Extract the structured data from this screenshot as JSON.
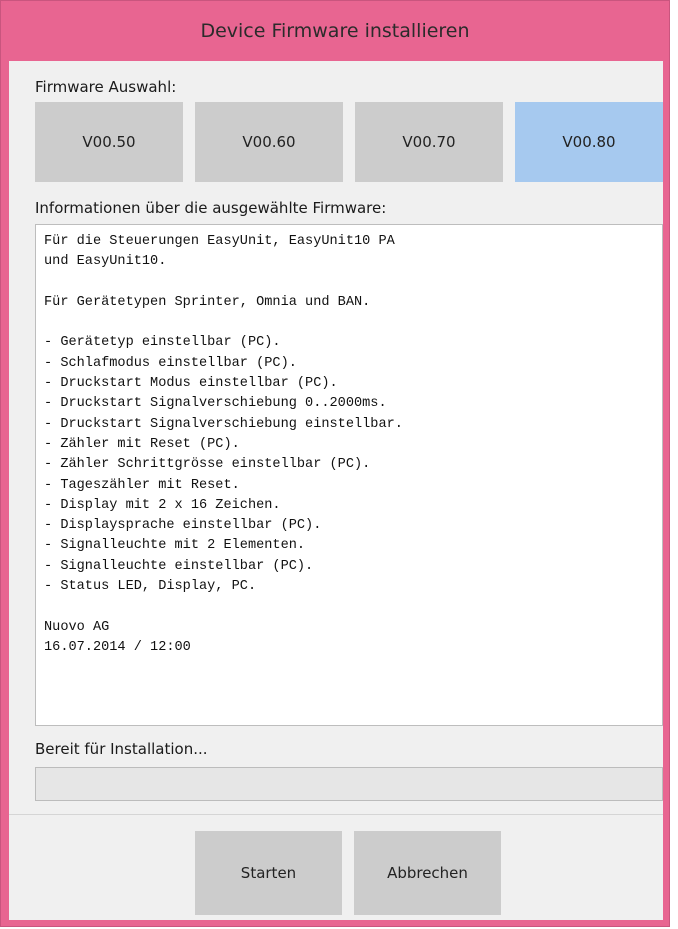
{
  "window": {
    "title": "Device Firmware installieren"
  },
  "firmware": {
    "section_label": "Firmware Auswahl:",
    "options": [
      {
        "label": "V00.50",
        "selected": false
      },
      {
        "label": "V00.60",
        "selected": false
      },
      {
        "label": "V00.70",
        "selected": false
      },
      {
        "label": "V00.80",
        "selected": true
      }
    ]
  },
  "info": {
    "label": "Informationen über die ausgewählte Firmware:",
    "text": "Für die Steuerungen EasyUnit, EasyUnit10 PA\nund EasyUnit10.\n\nFür Gerätetypen Sprinter, Omnia und BAN.\n\n- Gerätetyp einstellbar (PC).\n- Schlafmodus einstellbar (PC).\n- Druckstart Modus einstellbar (PC).\n- Druckstart Signalverschiebung 0..2000ms.\n- Druckstart Signalverschiebung einstellbar.\n- Zähler mit Reset (PC).\n- Zähler Schrittgrösse einstellbar (PC).\n- Tageszähler mit Reset.\n- Display mit 2 x 16 Zeichen.\n- Displaysprache einstellbar (PC).\n- Signalleuchte mit 2 Elementen.\n- Signalleuchte einstellbar (PC).\n- Status LED, Display, PC.\n\nNuovo AG\n16.07.2014 / 12:00"
  },
  "status": {
    "text": "Bereit für Installation...",
    "progress": 0
  },
  "actions": {
    "start_label": "Starten",
    "cancel_label": "Abbrechen"
  },
  "colors": {
    "window_frame": "#e86591",
    "button_bg": "#cccccc",
    "selected_button_bg": "#a6c9ef",
    "client_bg": "#f0f0f0"
  }
}
